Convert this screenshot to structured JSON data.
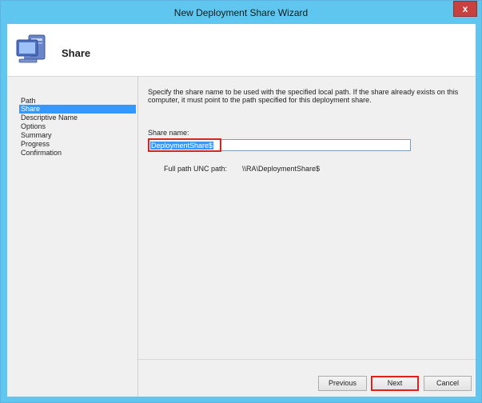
{
  "window": {
    "title": "New Deployment Share Wizard",
    "close_glyph": "x"
  },
  "header": {
    "title": "Share",
    "icon": "computer-icon"
  },
  "nav": {
    "items": [
      {
        "label": "Path"
      },
      {
        "label": "Share"
      },
      {
        "label": "Descriptive Name"
      },
      {
        "label": "Options"
      },
      {
        "label": "Summary"
      },
      {
        "label": "Progress"
      },
      {
        "label": "Confirmation"
      }
    ],
    "active_index": 1
  },
  "content": {
    "description": "Specify the share name to be used with the specified local path.  If the share already exists on this computer, it must point to the path specified for this deployment share.",
    "share_label": "Share name:",
    "share_value": "DeploymentShare$",
    "unc_label": "Full path UNC path:",
    "unc_value": "\\\\RA\\DeploymentShare$"
  },
  "buttons": {
    "previous": "Previous",
    "next": "Next",
    "cancel": "Cancel"
  },
  "colors": {
    "titlebar": "#5ec6ef",
    "selection": "#3399ff",
    "highlight": "#e0201a"
  }
}
